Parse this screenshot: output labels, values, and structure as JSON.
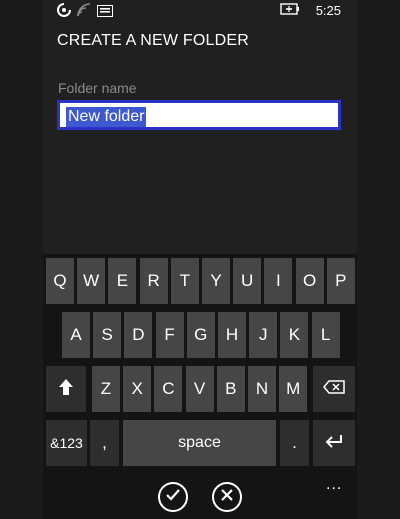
{
  "status": {
    "time": "5:25",
    "icons": [
      "notification-icon",
      "wifi-icon",
      "message-icon",
      "battery-charging-icon"
    ]
  },
  "title": "CREATE A NEW FOLDER",
  "folder_name": {
    "label": "Folder name",
    "value": "New folder"
  },
  "keyboard": {
    "row1": [
      "Q",
      "W",
      "E",
      "R",
      "T",
      "Y",
      "U",
      "I",
      "O",
      "P"
    ],
    "row2": [
      "A",
      "S",
      "D",
      "F",
      "G",
      "H",
      "J",
      "K",
      "L"
    ],
    "row3": [
      "Z",
      "X",
      "C",
      "V",
      "B",
      "N",
      "M"
    ],
    "row4": {
      "numbers": "&123",
      "comma": ",",
      "space": "space",
      "period": "."
    }
  },
  "app_bar": {
    "icons": [
      "checkmark-icon",
      "cancel-icon",
      "more-icon"
    ],
    "more": "..."
  }
}
